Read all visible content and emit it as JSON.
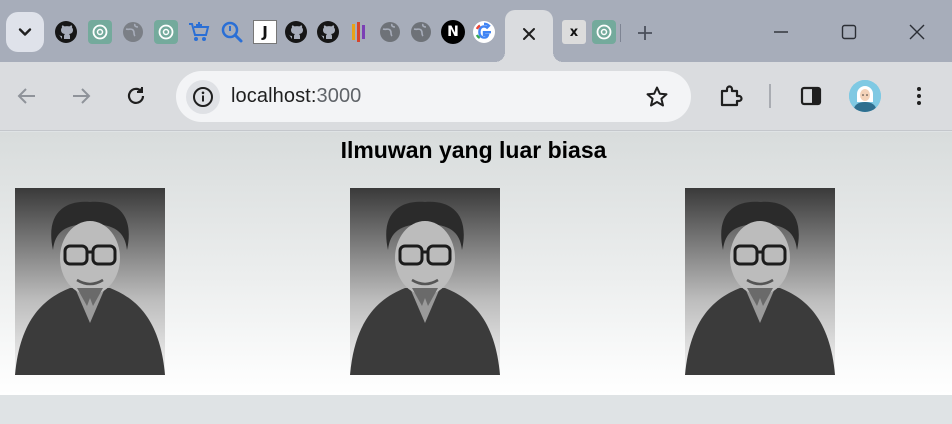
{
  "browser": {
    "tabs": {
      "active_tab_close_icon": "close-icon",
      "inactive_tab_label": "x",
      "j_tab_label": "J",
      "next_tab_label": "N"
    },
    "address_bar": {
      "host": "localhost:",
      "port": "3000"
    }
  },
  "page": {
    "title": "Ilmuwan yang luar biasa",
    "images": [
      {
        "icon": "scientist-photo"
      },
      {
        "icon": "scientist-photo"
      },
      {
        "icon": "scientist-photo"
      }
    ]
  },
  "colors": {
    "tab_strip": "#a7adba",
    "toolbar": "#dadcdf",
    "omnibox": "#f3f4f6"
  }
}
